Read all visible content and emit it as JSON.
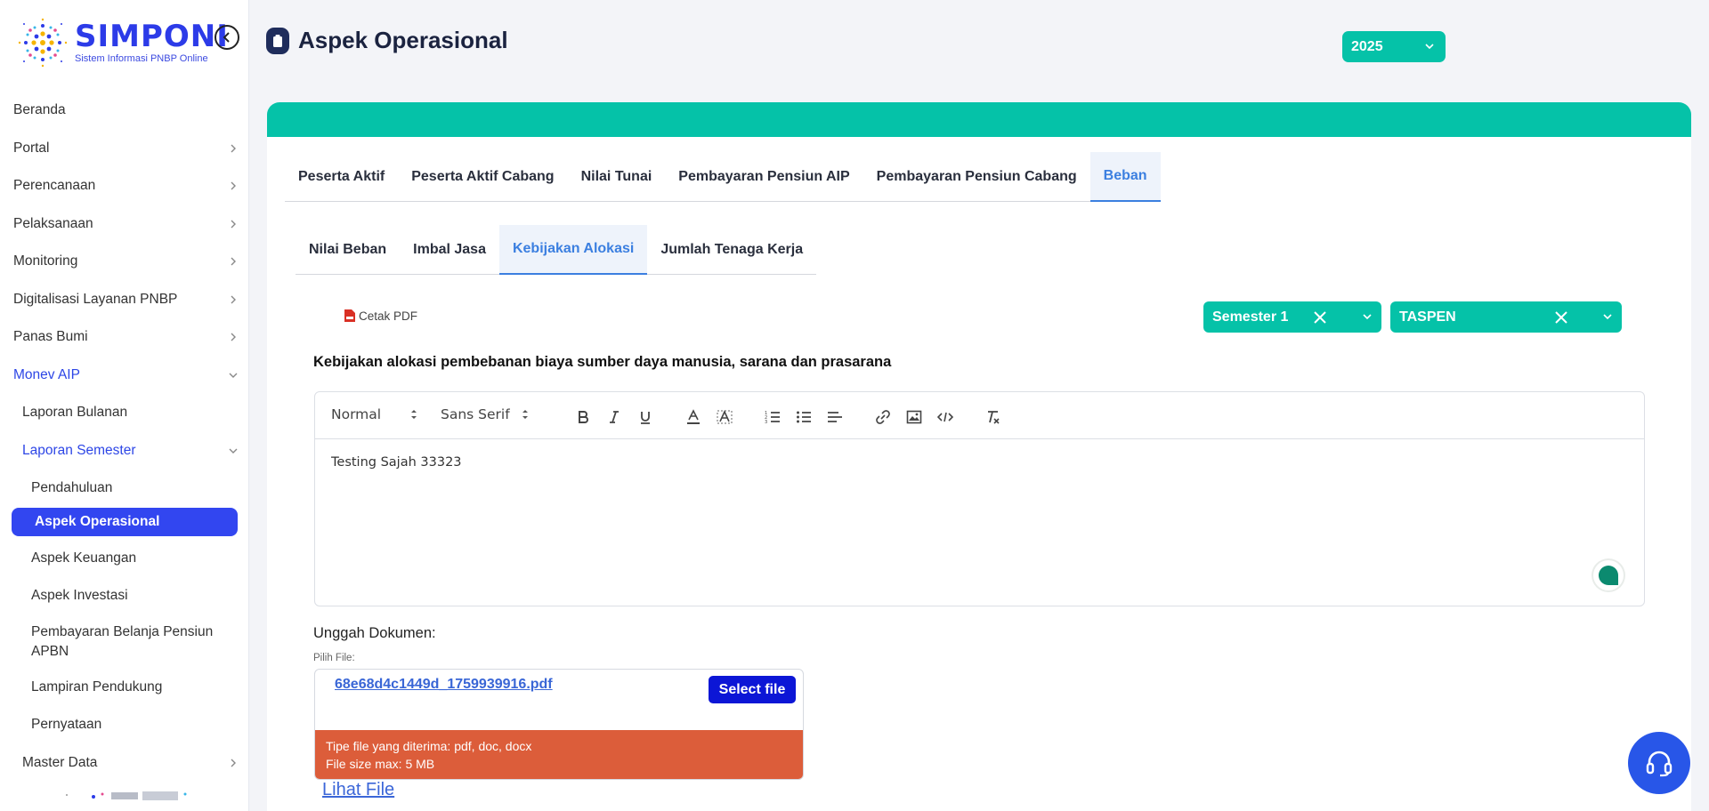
{
  "brand": {
    "title": "SIMPONI",
    "subtitle": "Sistem Informasi PNBP Online"
  },
  "sidebar": {
    "items": [
      {
        "label": "Beranda"
      },
      {
        "label": "Portal"
      },
      {
        "label": "Perencanaan"
      },
      {
        "label": "Pelaksanaan"
      },
      {
        "label": "Monitoring"
      },
      {
        "label": "Digitalisasi Layanan PNBP"
      },
      {
        "label": "Panas Bumi"
      },
      {
        "label": "Monev AIP"
      },
      {
        "label": "Laporan Bulanan"
      },
      {
        "label": "Laporan Semester"
      },
      {
        "label": "Pendahuluan"
      },
      {
        "label": "Aspek Operasional"
      },
      {
        "label": "Aspek Keuangan"
      },
      {
        "label": "Aspek Investasi"
      },
      {
        "label": "Pembayaran Belanja Pensiun APBN"
      },
      {
        "label": "Lampiran Pendukung"
      },
      {
        "label": "Pernyataan"
      },
      {
        "label": "Master Data"
      }
    ]
  },
  "header": {
    "title": "Aspek Operasional",
    "year": "2025"
  },
  "tabs": {
    "primary": [
      "Peserta Aktif",
      "Peserta Aktif Cabang",
      "Nilai Tunai",
      "Pembayaran Pensiun AIP",
      "Pembayaran Pensiun Cabang",
      "Beban"
    ],
    "primary_active": "Beban",
    "secondary": [
      "Nilai Beban",
      "Imbal Jasa",
      "Kebijakan Alokasi",
      "Jumlah Tenaga Kerja"
    ],
    "secondary_active": "Kebijakan Alokasi"
  },
  "actions": {
    "print_pdf": "Cetak PDF"
  },
  "filters": {
    "semester": "Semester 1",
    "entity": "TASPEN"
  },
  "section": {
    "heading": "Kebijakan alokasi pembebanan biaya sumber daya manusia, sarana dan prasarana"
  },
  "editor": {
    "format": "Normal",
    "font": "Sans Serif",
    "content": "Testing Sajah 33323"
  },
  "upload": {
    "label": "Unggah Dokumen:",
    "choose_label": "Pilih File:",
    "file_name": "68e68d4c1449d_1759939916.pdf",
    "select_button": "Select file",
    "hint_types": "Tipe file yang diterima: pdf, doc, docx",
    "hint_size": "File size max: 5 MB",
    "view_link": "Lihat File"
  },
  "colors": {
    "primary": "#2c3be8",
    "teal": "#05c2a8",
    "active_tab": "#3b7fe0",
    "warning": "#dc5d3a",
    "fab": "#2856e8"
  }
}
